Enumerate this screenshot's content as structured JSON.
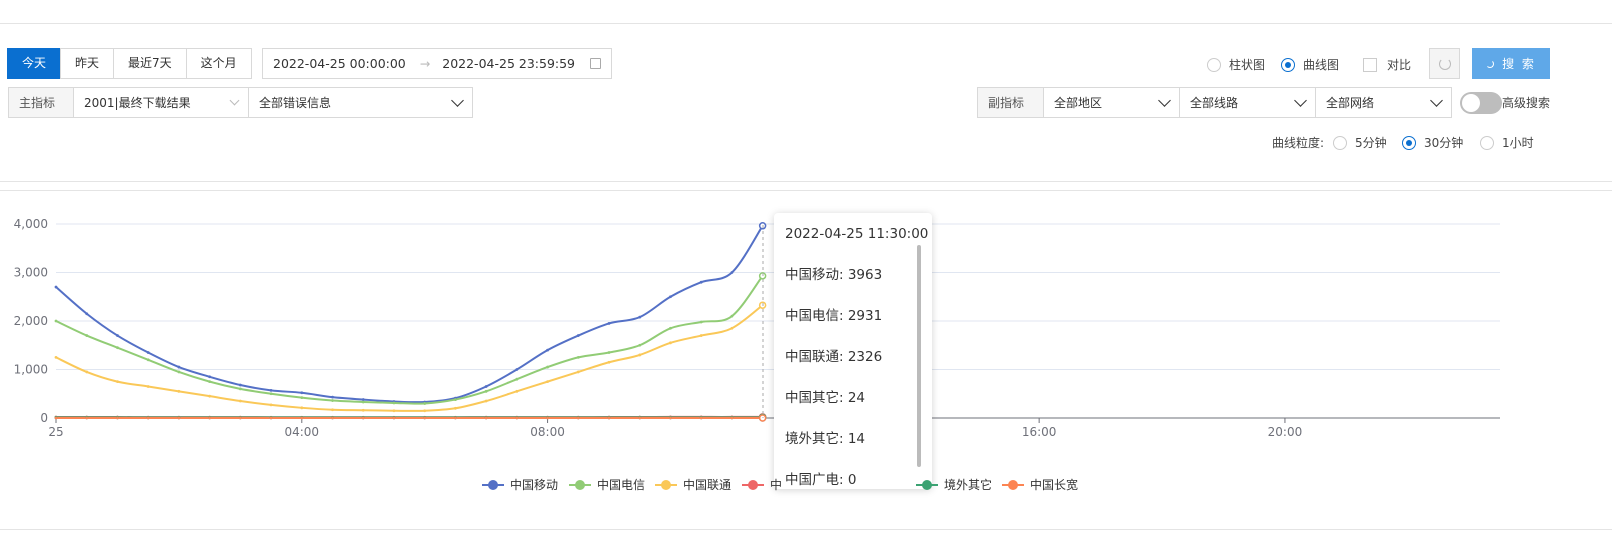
{
  "quick_ranges": [
    "今天",
    "昨天",
    "最近7天",
    "这个月"
  ],
  "range": {
    "start": "2022-04-25 00:00:00",
    "arrow": "→",
    "end": "2022-04-25 23:59:59"
  },
  "primary": {
    "label": "主指标",
    "metric": "2001|最终下载结果",
    "error": "全部错误信息"
  },
  "secondary": {
    "label": "副指标",
    "region": "全部地区",
    "line": "全部线路",
    "network": "全部网络"
  },
  "chart_modes": {
    "bar": "柱状图",
    "line": "曲线图",
    "selected": "line"
  },
  "compare_label": "对比",
  "search_label": "搜 索",
  "advanced_label": "高级搜索",
  "granularity": {
    "label": "曲线粒度:",
    "options": [
      "5分钟",
      "30分钟",
      "1小时"
    ],
    "selected": "30分钟"
  },
  "tooltip": {
    "title": "2022-04-25 11:30:00",
    "rows": [
      "中国移动: 3963",
      "中国电信: 2931",
      "中国联通: 2326",
      "中国其它: 24",
      "境外其它: 14",
      "中国广电: 0"
    ]
  },
  "chart_data": {
    "type": "line",
    "x_ticks": [
      "25",
      "04:00",
      "08:00",
      "16:00",
      "20:00"
    ],
    "y_ticks": [
      "0",
      "1,000",
      "2,000",
      "3,000",
      "4,000"
    ],
    "ylim": [
      0,
      4000
    ],
    "xlim_hours": [
      0,
      23.5
    ],
    "x_hours": [
      0,
      0.5,
      1,
      1.5,
      2,
      2.5,
      3,
      3.5,
      4,
      4.5,
      5,
      5.5,
      6,
      6.5,
      7,
      7.5,
      8,
      8.5,
      9,
      9.5,
      10,
      10.5,
      11,
      11.5
    ],
    "series": [
      {
        "name": "中国移动",
        "color": "#5470c6",
        "values": [
          2700,
          2150,
          1700,
          1350,
          1050,
          850,
          680,
          570,
          520,
          430,
          380,
          340,
          330,
          410,
          650,
          1000,
          1400,
          1700,
          1950,
          2080,
          2500,
          2800,
          3000,
          3963
        ]
      },
      {
        "name": "中国电信",
        "color": "#91cc75",
        "values": [
          2000,
          1700,
          1450,
          1200,
          950,
          750,
          600,
          500,
          420,
          360,
          330,
          310,
          300,
          380,
          550,
          800,
          1050,
          1250,
          1350,
          1500,
          1850,
          1980,
          2100,
          2931
        ]
      },
      {
        "name": "中国联通",
        "color": "#fac858",
        "values": [
          1250,
          950,
          750,
          650,
          550,
          450,
          350,
          270,
          210,
          170,
          160,
          150,
          150,
          200,
          350,
          550,
          750,
          950,
          1150,
          1300,
          1550,
          1700,
          1850,
          2326
        ]
      },
      {
        "name": "中国其它",
        "color": "#ee6666",
        "values": [
          20,
          20,
          20,
          18,
          18,
          18,
          18,
          16,
          16,
          16,
          16,
          16,
          16,
          16,
          18,
          18,
          18,
          18,
          20,
          20,
          22,
          22,
          22,
          24
        ]
      },
      {
        "name": "中国广电",
        "color": "#73c0de",
        "values": [
          0,
          0,
          0,
          0,
          0,
          0,
          0,
          0,
          0,
          0,
          0,
          0,
          0,
          0,
          0,
          0,
          0,
          0,
          0,
          0,
          0,
          0,
          0,
          0
        ]
      },
      {
        "name": "境外其它",
        "color": "#3ba272",
        "values": [
          14,
          14,
          14,
          12,
          12,
          12,
          12,
          12,
          12,
          12,
          12,
          12,
          12,
          12,
          12,
          12,
          12,
          12,
          12,
          14,
          14,
          14,
          14,
          14
        ]
      },
      {
        "name": "中国长宽",
        "color": "#fc8452",
        "values": [
          0,
          0,
          0,
          0,
          0,
          0,
          0,
          0,
          0,
          0,
          0,
          0,
          0,
          0,
          0,
          0,
          0,
          0,
          0,
          0,
          0,
          0,
          0,
          0
        ]
      }
    ],
    "legend_visible": [
      {
        "name": "中国移动",
        "color": "#5470c6"
      },
      {
        "name": "中国电信",
        "color": "#91cc75"
      },
      {
        "name": "中国联通",
        "color": "#fac858"
      },
      {
        "name": "中",
        "color": "#ee6666"
      },
      {
        "name": "境外其它",
        "color": "#3ba272"
      },
      {
        "name": "中国长宽",
        "color": "#fc8452"
      }
    ],
    "grid": true,
    "legend_position": "bottom"
  }
}
